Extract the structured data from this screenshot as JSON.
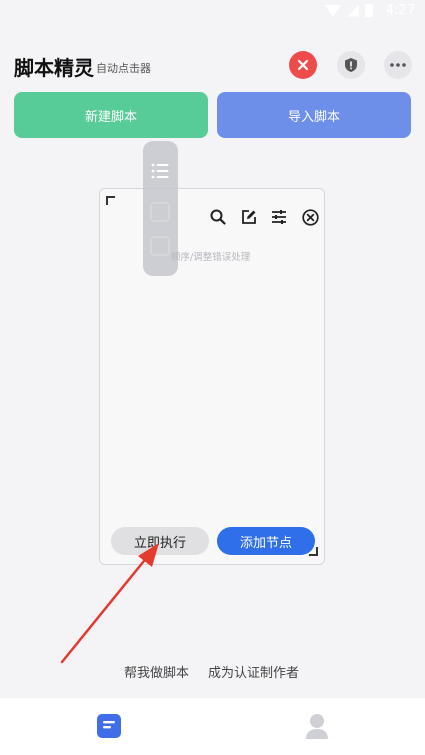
{
  "status_bar": {
    "time": "4:27"
  },
  "header": {
    "title": "脚本精灵",
    "subtitle": "自动点击器"
  },
  "actions": {
    "new_script": "新建脚本",
    "import_script": "导入脚本"
  },
  "panel": {
    "hint": "顺序/调整错误处理",
    "execute_now": "立即执行",
    "add_node": "添加节点"
  },
  "footer": {
    "help_me": "帮我做脚本",
    "become_author": "成为认证制作者"
  },
  "colors": {
    "accent_green": "#58cc98",
    "accent_blue": "#6d8fe9",
    "primary_blue": "#2f6fea",
    "danger_red": "#ee4b4b",
    "arrow_red": "#e53a2f"
  }
}
